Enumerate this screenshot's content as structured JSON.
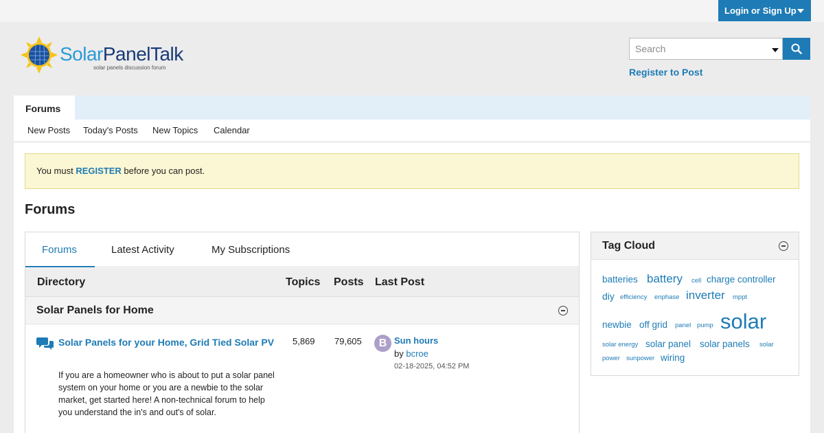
{
  "header": {
    "login_label": "Login or Sign Up",
    "logo": {
      "name_part1": "Solar",
      "name_part2": "PanelTalk",
      "tagline": "solar panels discussion forum"
    },
    "search_placeholder": "Search",
    "register_label": "Register to Post"
  },
  "nav": {
    "main_tab": "Forums",
    "subnav": [
      "New Posts",
      "Today's Posts",
      "New Topics",
      "Calendar"
    ]
  },
  "notice": {
    "prefix": "You must ",
    "link": "REGISTER",
    "suffix": " before you can post."
  },
  "page_title": "Forums",
  "tabs": [
    "Forums",
    "Latest Activity",
    "My Subscriptions"
  ],
  "directory": {
    "headers": {
      "directory": "Directory",
      "topics": "Topics",
      "posts": "Posts",
      "last_post": "Last Post"
    },
    "category": "Solar Panels for Home",
    "forums": [
      {
        "title": "Solar Panels for your Home, Grid Tied Solar PV",
        "description": "If you are a homeowner who is about to put a solar panel system on your home or you are a newbie to the solar market, get started here! A non-technical forum to help you understand the in's and out's of solar.",
        "topics": "5,869",
        "posts": "79,605",
        "last_post": {
          "avatar_letter": "B",
          "title": "Sun hours",
          "by": "by",
          "user": "bcroe",
          "date": "02-18-2025, 04:52 PM"
        }
      }
    ]
  },
  "tag_cloud": {
    "title": "Tag Cloud",
    "tags": [
      "batteries",
      "battery",
      "cell",
      "charge controller",
      "diy",
      "efficiency",
      "enphase",
      "inverter",
      "mppt",
      "newbie",
      "off grid",
      "panel",
      "pump",
      "solar",
      "solar energy",
      "solar panel",
      "solar panels",
      "solar",
      "power",
      "sunpower",
      "wiring"
    ]
  },
  "colors": {
    "accent": "#1e7bb5",
    "notice_bg": "#fbf6d3",
    "nav_bg": "#e2eef8"
  }
}
